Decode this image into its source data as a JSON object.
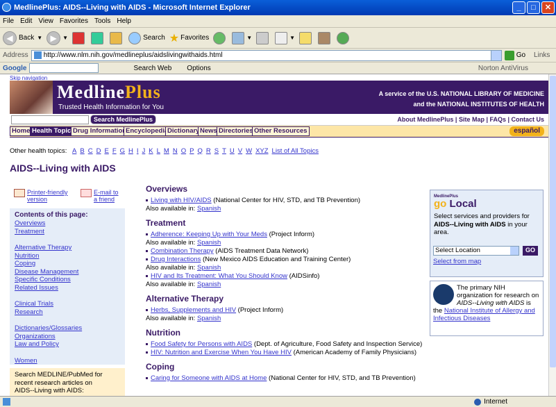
{
  "window": {
    "title": "MedlinePlus: AIDS--Living with AIDS - Microsoft Internet Explorer"
  },
  "menu": [
    "File",
    "Edit",
    "View",
    "Favorites",
    "Tools",
    "Help"
  ],
  "toolbar": {
    "back": "Back",
    "search": "Search",
    "favorites": "Favorites"
  },
  "address": {
    "label": "Address",
    "url": "http://www.nlm.nih.gov/medlineplus/aidslivingwithaids.html",
    "go": "Go",
    "links": "Links"
  },
  "google": {
    "label": "Google",
    "search_web": "Search Web",
    "options": "Options",
    "norton": "Norton AntiVirus"
  },
  "header": {
    "skip": "Skip navigation",
    "logo_main": "Medline",
    "logo_plus": "Plus",
    "tagline": "Trusted Health Information for You",
    "service_line1": "A service of the U.S. NATIONAL LIBRARY OF MEDICINE",
    "service_line2": "and the NATIONAL INSTITUTES OF HEALTH",
    "search_button": "Search MedlinePlus",
    "top_links": "About MedlinePlus | Site Map | FAQs | Contact Us",
    "espanol": "español"
  },
  "nav": {
    "tabs": [
      "Home",
      "Health Topics",
      "Drug Information",
      "Encyclopedia",
      "Dictionary",
      "News",
      "Directories",
      "Other Resources"
    ]
  },
  "topics": {
    "label": "Other health topics:",
    "letters": [
      "A",
      "B",
      "C",
      "D",
      "E",
      "F",
      "G",
      "H",
      "I",
      "J",
      "K",
      "L",
      "M",
      "N",
      "O",
      "P",
      "Q",
      "R",
      "S",
      "T",
      "U",
      "V",
      "W",
      "XYZ",
      "List of All Topics"
    ]
  },
  "page_title": "AIDS--Living with AIDS",
  "tools": {
    "printer1": "Printer-friendly",
    "printer2": "version",
    "email1": "E-mail to",
    "email2": "a friend"
  },
  "contents": {
    "heading": "Contents of this page:",
    "group1": [
      "Overviews",
      "Treatment"
    ],
    "group2": [
      "Alternative Therapy",
      "Nutrition",
      "Coping",
      "Disease Management",
      "Specific Conditions",
      "Related Issues"
    ],
    "group3": [
      "Clinical Trials",
      "Research"
    ],
    "group4": [
      "Dictionaries/Glossaries",
      "Organizations",
      "Law and Policy"
    ],
    "group5": [
      "Women"
    ]
  },
  "medline_box": {
    "line1": "Search MEDLINE/PubMed for",
    "line2": "recent research articles on",
    "line3": "AIDS--Living with AIDS:"
  },
  "main": {
    "overviews": {
      "h": "Overviews",
      "i1_link": "Living with HIV/AIDS",
      "i1_src": " (National Center for HIV, STD, and TB Prevention)",
      "also": "Also available in: ",
      "spanish": "Spanish"
    },
    "treatment": {
      "h": "Treatment",
      "i1_link": "Adherence: Keeping Up with Your Meds",
      "i1_src": " (Project Inform)",
      "i2_link": "Combination Therapy",
      "i2_src": " (AIDS Treatment Data Network)",
      "i3_link": "Drug Interactions",
      "i3_src": " (New Mexico AIDS Education and Training Center)",
      "i4_link": "HIV and Its Treatment: What You Should Know",
      "i4_src": " (AIDSinfo)"
    },
    "alt": {
      "h": "Alternative Therapy",
      "i1_link": "Herbs, Supplements and HIV",
      "i1_src": " (Project Inform)"
    },
    "nutrition": {
      "h": "Nutrition",
      "i1_link": "Food Safety for Persons with AIDS",
      "i1_src": " (Dept. of Agriculture, Food Safety and Inspection Service)",
      "i2_link": "HIV: Nutrition and Exercise When You Have HIV",
      "i2_src": " (American Academy of Family Physicians)"
    },
    "coping": {
      "h": "Coping",
      "i1_link": "Caring for Someone with AIDS at Home",
      "i1_src": " (National Center for HIV, STD, and TB Prevention)"
    }
  },
  "golocal": {
    "small": "MedlinePlus",
    "go": "go",
    "local": "Local",
    "text1": "Select services and providers for ",
    "bold": "AIDS--Living with AIDS",
    "text2": " in your area.",
    "select": "Select Location",
    "go_btn": "GO",
    "map": "Select from map"
  },
  "niaid": {
    "t1": "The primary NIH organization for research on ",
    "t1i": "AIDS--Living with AIDS",
    "t2": " is the ",
    "link": "National Institute of Allergy and Infectious Diseases"
  },
  "status": {
    "zone": "Internet"
  }
}
